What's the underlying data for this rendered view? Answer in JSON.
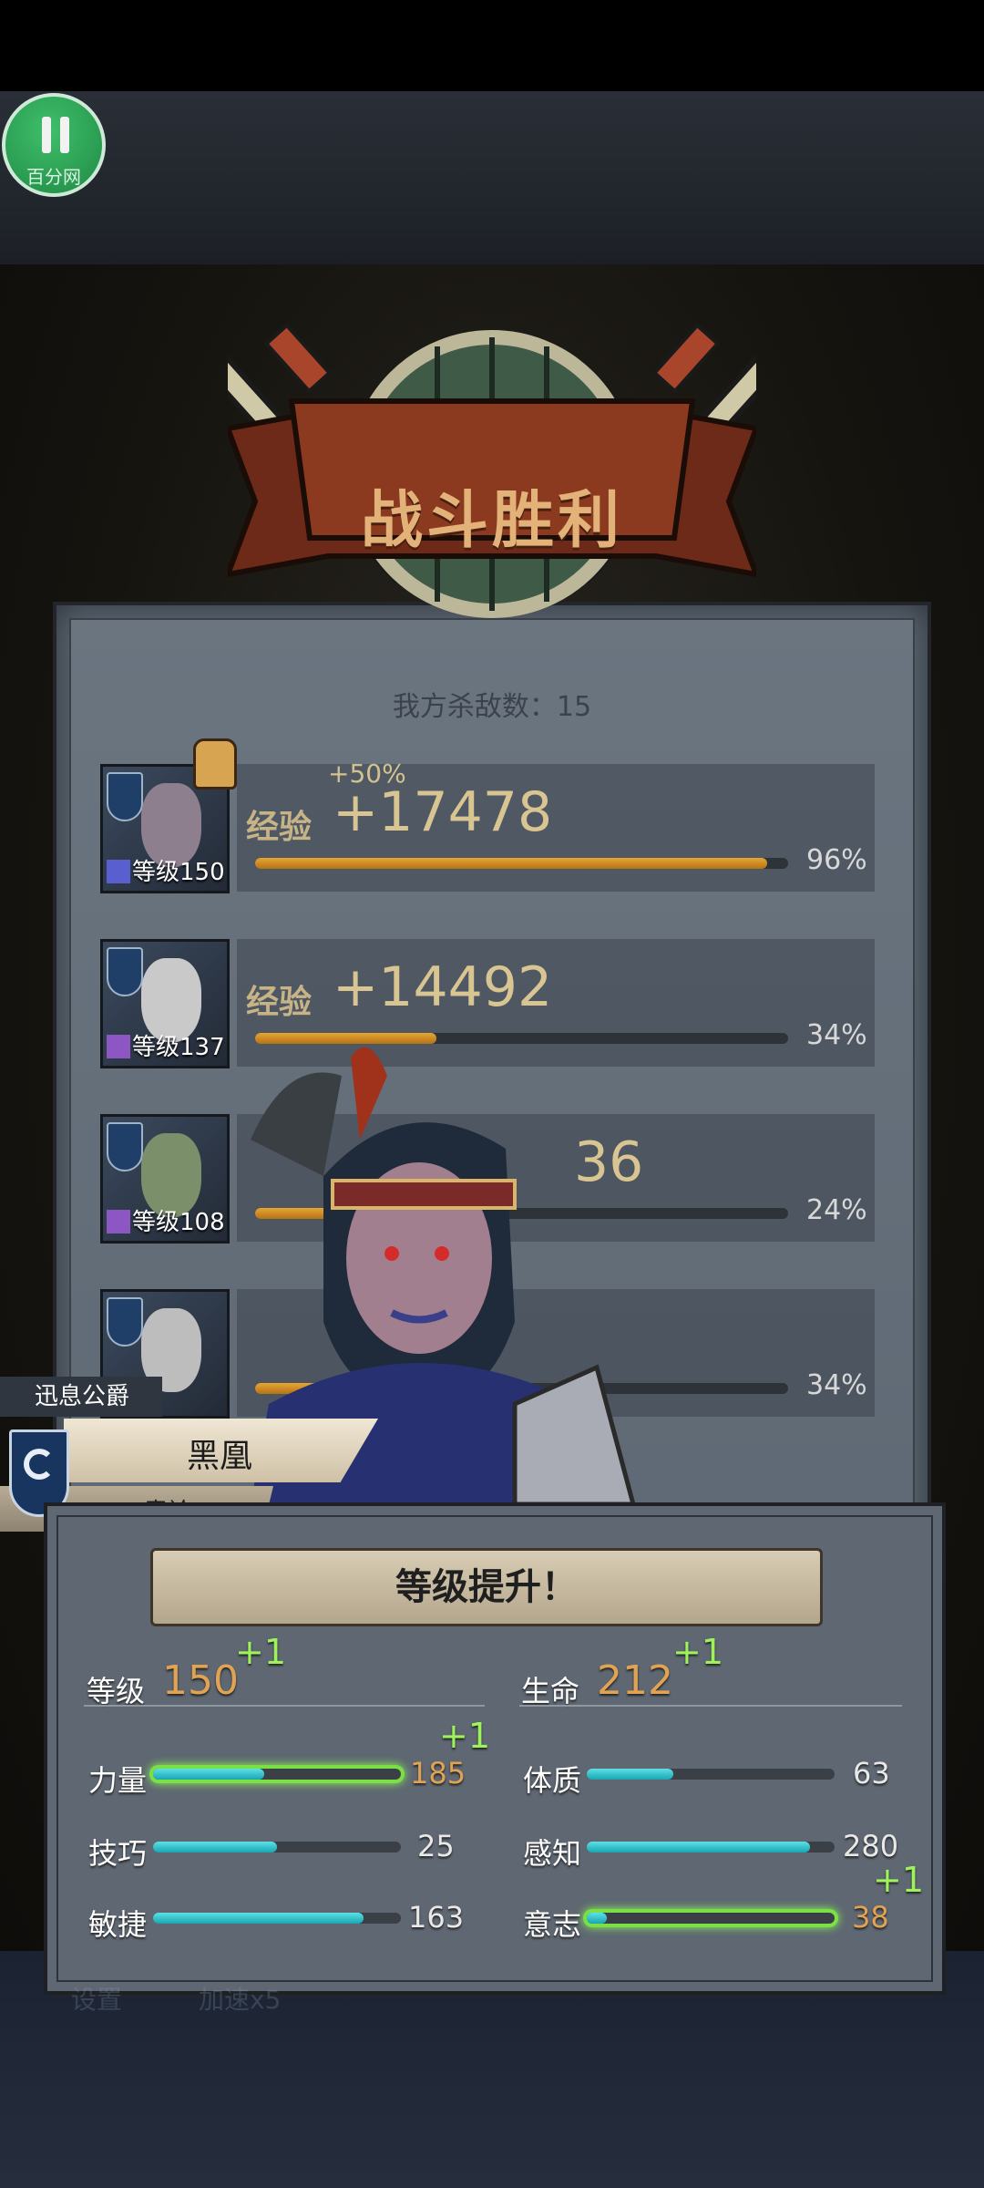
{
  "hud": {
    "pause_watermark": "百分网"
  },
  "banner": {
    "title": "战斗胜利"
  },
  "kills": {
    "text": "我方杀敌数：15"
  },
  "exp_label": "经验",
  "party": [
    {
      "level_label": "等级150",
      "xp": "+17478",
      "bonus": "+50%",
      "percent_text": "96%",
      "percent": 96
    },
    {
      "level_label": "等级137",
      "xp": "+14492",
      "bonus": "",
      "percent_text": "34%",
      "percent": 34
    },
    {
      "level_label": "等级108",
      "xp": "36",
      "bonus": "",
      "percent_text": "24%",
      "percent": 24
    },
    {
      "level_label": "",
      "xp": "",
      "bonus": "",
      "percent_text": "34%",
      "percent": 34
    }
  ],
  "hero": {
    "title": "迅息公爵",
    "name": "黑凰",
    "subtitle": "青衿"
  },
  "levelup": {
    "heading": "等级提升！",
    "level": {
      "label": "等级",
      "value": "150",
      "delta": "+1"
    },
    "life": {
      "label": "生命",
      "value": "212",
      "delta": "+1"
    },
    "stats": [
      {
        "label": "力量",
        "value": "185",
        "delta": "+1",
        "fill": 0.45,
        "highlight": true
      },
      {
        "label": "技巧",
        "value": "25",
        "delta": "",
        "fill": 0.5,
        "highlight": false
      },
      {
        "label": "敏捷",
        "value": "163",
        "delta": "",
        "fill": 0.85,
        "highlight": false
      },
      {
        "label": "体质",
        "value": "63",
        "delta": "",
        "fill": 0.35,
        "highlight": false
      },
      {
        "label": "感知",
        "value": "280",
        "delta": "",
        "fill": 0.9,
        "highlight": false
      },
      {
        "label": "意志",
        "value": "38",
        "delta": "+1",
        "fill": 0.08,
        "highlight": true
      }
    ]
  },
  "bottom_ghost": {
    "left": "设置",
    "right": "加速x5"
  }
}
